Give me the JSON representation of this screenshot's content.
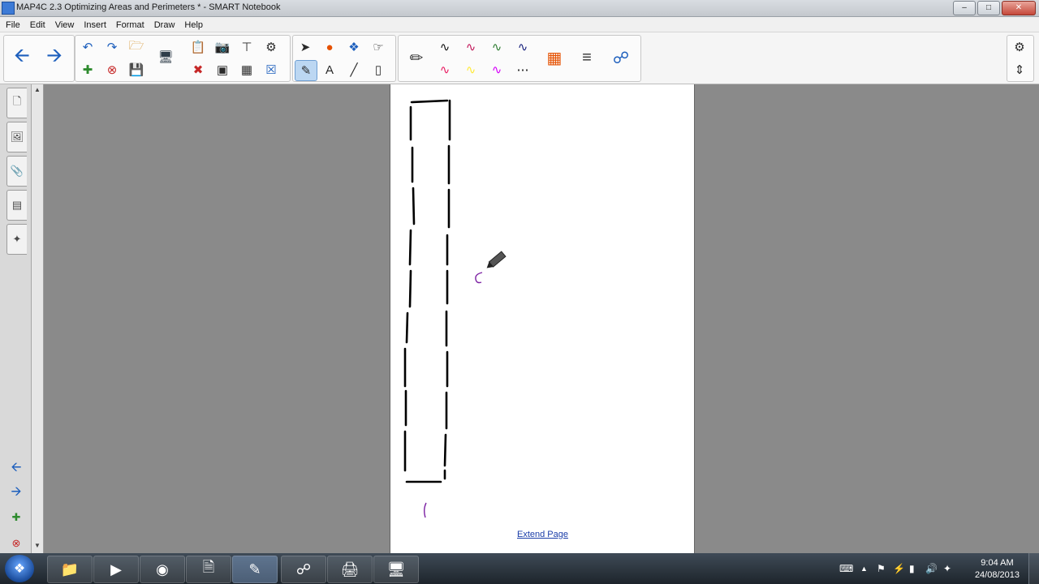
{
  "window": {
    "title": "MAP4C 2.3 Optimizing Areas and Perimeters * - SMART Notebook"
  },
  "menu": {
    "file": "File",
    "edit": "Edit",
    "view": "View",
    "insert": "Insert",
    "format": "Format",
    "draw": "Draw",
    "help": "Help"
  },
  "toolbar": {
    "icons": [
      "back-arrow-icon",
      "forward-arrow-icon",
      "undo-icon",
      "redo-icon",
      "open-file-icon",
      "add-page-icon",
      "delete-page-icon",
      "save-icon",
      "display-screen-icon",
      "paste-icon",
      "delete-icon",
      "screen-shade-icon",
      "table-icon",
      "capture-icon",
      "select-icon",
      "shapes-icon",
      "fill-icon",
      "eraser-icon",
      "pen-icon",
      "line-icon",
      "text-icon",
      "magic-pen-icon",
      "color-palette-icon",
      "properties-icon",
      "link-icon",
      "settings-gear-icon",
      "move-toolbar-icon"
    ],
    "pen_colors": [
      "#111111",
      "#c2185b",
      "#2e7d32",
      "#1a237e",
      "#e91e63",
      "#ffeb3b",
      "#d500f9",
      "#000000"
    ]
  },
  "sidebar": {
    "tabs": [
      "page-sorter",
      "gallery",
      "attachments",
      "properties",
      "addons"
    ]
  },
  "page": {
    "extend_link": "Extend Page"
  },
  "taskbar": {
    "time": "9:04 AM",
    "date": "24/08/2013"
  },
  "colors": {
    "ink": "#000000",
    "accent_ink": "#7b1fa2",
    "link": "#1a3da8"
  }
}
